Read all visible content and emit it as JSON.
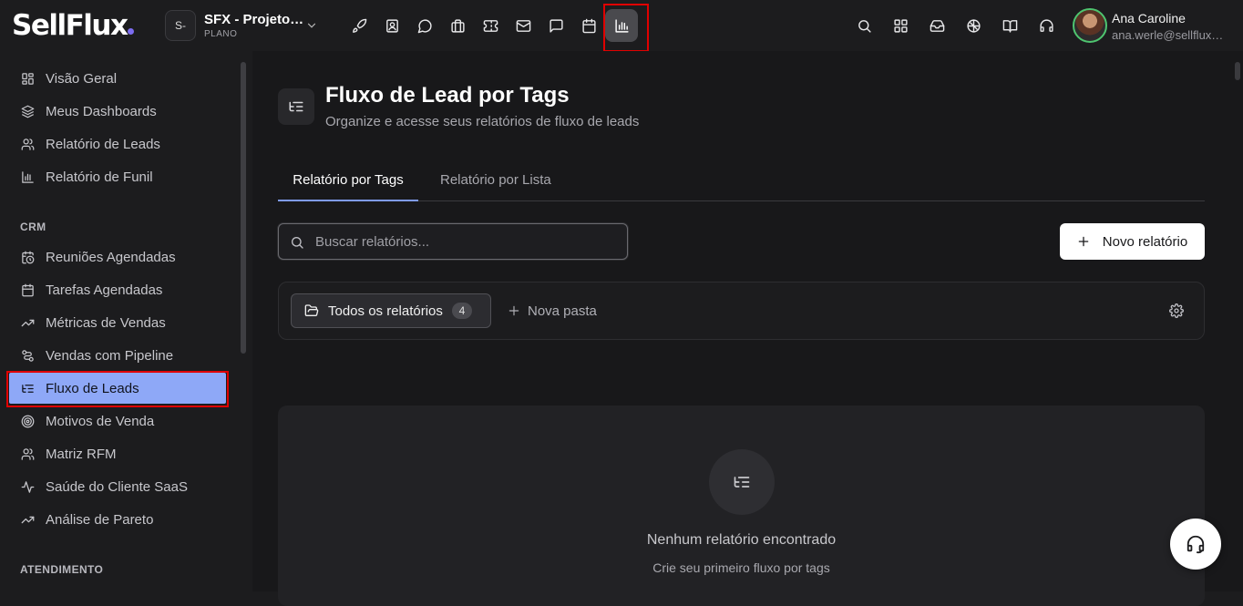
{
  "brand": {
    "logo_text": "SellFlux",
    "accent": "#7c6cf0"
  },
  "project": {
    "badge": "S-",
    "name": "SFX - Projeto…",
    "plan": "PLANO"
  },
  "topnav": {
    "icons": [
      "rocket-icon",
      "contact-card-icon",
      "chat-bubble-icon",
      "briefcase-icon",
      "ticket-icon",
      "mail-icon",
      "message-square-icon",
      "calendar-icon",
      "bar-chart-icon"
    ],
    "active": "bar-chart-icon",
    "right_icons": [
      "search-icon",
      "grid-icon",
      "inbox-icon",
      "brain-icon",
      "book-open-icon",
      "headset-icon"
    ]
  },
  "user": {
    "name": "Ana Caroline",
    "email": "ana.werle@sellflux…"
  },
  "sidebar": {
    "items_top": [
      {
        "label": "Visão Geral",
        "icon": "dashboard-grid-icon"
      },
      {
        "label": "Meus Dashboards",
        "icon": "layers-icon"
      },
      {
        "label": "Relatório de Leads",
        "icon": "users-icon"
      },
      {
        "label": "Relatório de Funil",
        "icon": "bar-chart-icon"
      }
    ],
    "section_crm": "CRM",
    "items_crm": [
      {
        "label": "Reuniões Agendadas",
        "icon": "calendar-clock-icon"
      },
      {
        "label": "Tarefas Agendadas",
        "icon": "calendar-icon"
      },
      {
        "label": "Métricas de Vendas",
        "icon": "trending-up-icon"
      },
      {
        "label": "Vendas com Pipeline",
        "icon": "pipeline-icon"
      },
      {
        "label": "Fluxo de Leads",
        "icon": "list-tree-icon",
        "active": true
      },
      {
        "label": "Motivos de Venda",
        "icon": "target-icon"
      },
      {
        "label": "Matriz RFM",
        "icon": "users-icon"
      },
      {
        "label": "Saúde do Cliente SaaS",
        "icon": "activity-icon"
      },
      {
        "label": "Análise de Pareto",
        "icon": "trending-up-icon"
      }
    ],
    "section_atendimento": "ATENDIMENTO"
  },
  "page": {
    "title": "Fluxo de Lead por Tags",
    "subtitle": "Organize e acesse seus relatórios de fluxo de leads"
  },
  "tabs": [
    {
      "label": "Relatório por Tags",
      "active": true
    },
    {
      "label": "Relatório por Lista",
      "active": false
    }
  ],
  "search": {
    "placeholder": "Buscar relatórios...",
    "value": ""
  },
  "new_report_label": "Novo relatório",
  "folders": {
    "all_label": "Todos os relatórios",
    "all_count": "4",
    "new_folder_label": "Nova pasta"
  },
  "empty_state": {
    "title": "Nenhum relatório encontrado",
    "subtitle": "Crie seu primeiro fluxo por tags"
  }
}
